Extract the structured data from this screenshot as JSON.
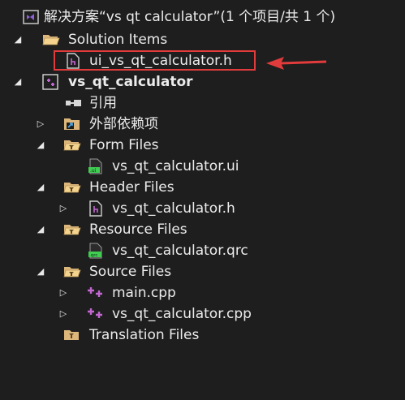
{
  "solution": {
    "title": "解决方案“vs qt calculator”(1 个项目/共 1 个)"
  },
  "tree": {
    "solution_items": {
      "label": "Solution Items"
    },
    "solution_items_file": {
      "label": "ui_vs_qt_calculator.h"
    },
    "project": {
      "label": "vs_qt_calculator"
    },
    "references": {
      "label": "引用"
    },
    "external_deps": {
      "label": "外部依赖项"
    },
    "form_files": {
      "label": "Form Files"
    },
    "form_file_ui": {
      "label": "vs_qt_calculator.ui"
    },
    "header_files": {
      "label": "Header Files"
    },
    "header_file_h": {
      "label": "vs_qt_calculator.h"
    },
    "resource_files": {
      "label": "Resource Files"
    },
    "resource_file_qrc": {
      "label": "vs_qt_calculator.qrc"
    },
    "source_files": {
      "label": "Source Files"
    },
    "source_main": {
      "label": "main.cpp"
    },
    "source_calc": {
      "label": "vs_qt_calculator.cpp"
    },
    "translation_files": {
      "label": "Translation Files"
    }
  },
  "colors": {
    "background": "#1e1e1e",
    "text": "#ececec",
    "folder": "#dcb67a",
    "highlight": "#e23b3b",
    "vs_purple": "#8e5fd6",
    "cpp_pink": "#c267d1"
  }
}
